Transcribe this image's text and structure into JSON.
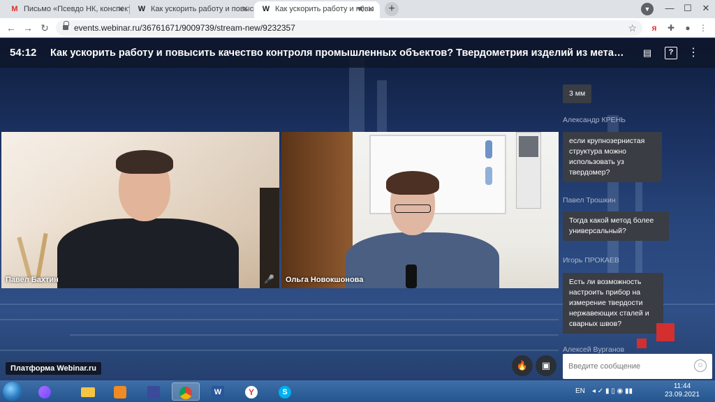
{
  "browser": {
    "tabs": [
      {
        "label": "Письмо «Псевдо НК, конспекты",
        "favicon": "gmail-icon"
      },
      {
        "label": "Как ускорить работу и повысит",
        "favicon": "webinar-icon"
      },
      {
        "label": "Как ускорить работу и повы",
        "favicon": "webinar-icon",
        "active": true
      }
    ],
    "url": "events.webinar.ru/36761671/9009739/stream-new/9232357",
    "window_controls": {
      "minimize": "—",
      "maximize": "☐",
      "close": "✕"
    }
  },
  "webinar": {
    "timer": "54:12",
    "title": "Как ускорить работу и повысить качество контроля промышленных объектов? Твердометрия изделий из мета…",
    "platform_badge": "Платформа Webinar.ru"
  },
  "videos": [
    {
      "name": "Павел Бахтин",
      "muted": true
    },
    {
      "name": "Ольга Новокшонова",
      "muted": false
    }
  ],
  "chat": {
    "messages": [
      {
        "author": "",
        "text": "3 мм"
      },
      {
        "author": "Александр КРЕНЬ",
        "text": "если крупнозернистая структура можно использовать уз твердомер?"
      },
      {
        "author": "Павел Трошкин",
        "text": "Тогда какой метод более универсальный?"
      },
      {
        "author": "Игорь ПРОКАЕВ",
        "text": "Есть ли возможность настроить прибор на измерение твердости нержавеющих сталей и сварных швов?"
      },
      {
        "author": "Алексей Вурганов",
        "text": ""
      }
    ],
    "input_placeholder": "Введите сообщение"
  },
  "taskbar": {
    "language": "EN",
    "time": "11:44",
    "date": "23.09.2021"
  },
  "colors": {
    "page_bg": "#1b3262",
    "chat_bubble": "#3a3d44",
    "accent_red": "#d32f2f"
  }
}
